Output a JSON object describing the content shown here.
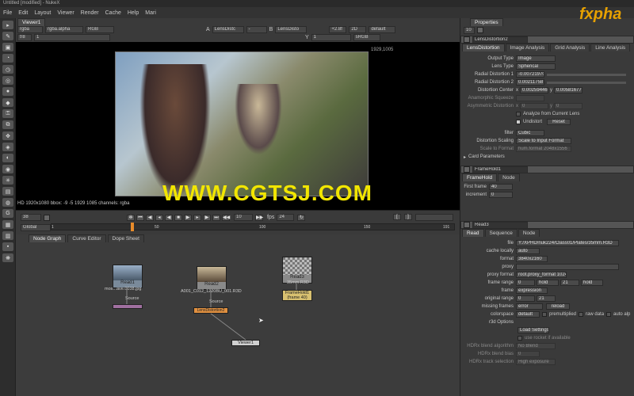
{
  "window": {
    "title": "Untitled [modified] - NukeX"
  },
  "menubar": [
    "File",
    "Edit",
    "Layout",
    "Viewer",
    "Render",
    "Cache",
    "Help",
    "Mari"
  ],
  "viewer": {
    "tab": "Viewer1",
    "channels": "rgba",
    "alpha": "rgba.alpha",
    "colorspace": "RGB",
    "input_a": "A",
    "input_a_node": "LensDistc",
    "input_b": "B",
    "input_b_node": "LensDisto",
    "gain": "+2.8f",
    "dim": "2D",
    "lut": "default",
    "lut2": "sRGB",
    "frame_label": "f/8",
    "frame_val": "1",
    "y_val": "Y",
    "zoom_val": "1",
    "resolution_label": "1929,1005",
    "status": "HD 1920x1080 bbox: -9 -5 1929 1085 channels: rgba",
    "frame_current": "38",
    "fps_label": "fps",
    "fps_val": "24",
    "count": "10",
    "scope": "Global",
    "ticks": [
      "1",
      "50",
      "100",
      "150",
      "191"
    ]
  },
  "watermark": "WWW.CGTSJ.COM",
  "logo": "fxpha",
  "nodegraph": {
    "tabs": [
      "Node Graph",
      "Curve Editor",
      "Dope Sheet"
    ],
    "nodes": {
      "read1": {
        "name": "Read1",
        "file": "mos...ave.0038.jpg",
        "out": "Source"
      },
      "read2": {
        "name": "Read2",
        "file": "A001_C012_1220BU_001.R3D",
        "out": "Source",
        "lens": "LensDistortion2"
      },
      "read3": {
        "name": "Read3",
        "file": "35mm.R3D"
      },
      "framehold": {
        "name": "FrameHold1",
        "sub": "(frame 40)"
      },
      "viewer": {
        "name": "Viewer1"
      }
    }
  },
  "properties": {
    "title": "Properties",
    "lens": {
      "node": "LensDistortion2",
      "tabs": [
        "LensDistortion",
        "Image Analysis",
        "Grid Analysis",
        "Line Analysis"
      ],
      "output_type_label": "Output Type",
      "output_type": "Image",
      "lens_type_label": "Lens Type",
      "lens_type": "Spherical",
      "rd1_label": "Radial Distortion 1",
      "rd1": "-0.00721970",
      "rd2_label": "Radial Distortion 2",
      "rd2": "0.00211758",
      "dc_label": "Distortion Center",
      "dc_x_label": "x",
      "dc_x": "0.00259446",
      "dc_y_label": "y",
      "dc_y": "0.00581677",
      "anam_label": "Anamorphic Squeeze",
      "asym_label": "Asymmetric Distortion",
      "asym_x_label": "x",
      "asym_x": "0",
      "asym_y_label": "y",
      "asym_y": "0",
      "analyze": "Analyze from Current Lens",
      "undistort": "Undistort",
      "reset": "Reset",
      "filter_label": "filter",
      "filter": "Cubic",
      "scaling_label": "Distortion Scaling",
      "scaling": "Scale to Input Format",
      "scale_format_label": "Scale to Format",
      "scale_format": "hum.format 2048x1556",
      "card": "Card Parameters"
    },
    "framehold": {
      "node": "FrameHold1",
      "tabs": [
        "FrameHold",
        "Node"
      ],
      "first_frame_label": "First frame",
      "first_frame": "40",
      "increment_label": "increment",
      "increment": "0"
    },
    "read3": {
      "node": "Read3",
      "tabs": [
        "Read",
        "Sequence",
        "Node"
      ],
      "file_label": "file",
      "file": "Y:/XPHD/nuk224/Class01/Plates/35mm.R3D",
      "cache_label": "cache locally",
      "cache": "auto",
      "format_label": "format",
      "format": "3840x2160",
      "proxy_label": "proxy",
      "proxy_format_label": "proxy format",
      "proxy_format": "root.proxy_format 1024x778",
      "frame_range_label": "frame range",
      "fr_start": "0",
      "fr_mode": "hold",
      "fr_end": "21",
      "fr_mode2": "hold",
      "frame_label": "frame",
      "frame": "expression",
      "orig_range_label": "original range",
      "or_start": "0",
      "or_end": "21",
      "missing_label": "missing frames",
      "missing": "error",
      "reload": "reload",
      "colorspace_label": "colorspace",
      "colorspace": "default",
      "premult": "premultiplied",
      "raw": "raw data",
      "auto": "auto alp",
      "r3d_label": "r3d Options",
      "load": "Load Settings",
      "rocket": "use rocket if available",
      "hdrx_algo_label": "HDRx blend algorithm",
      "hdrx_algo": "No Blend",
      "hdrx_bias_label": "HDRx blend bias",
      "hdrx_bias": "0",
      "hdrx_track_label": "HDRx track selection",
      "hdrx_track": "High exposure"
    }
  }
}
